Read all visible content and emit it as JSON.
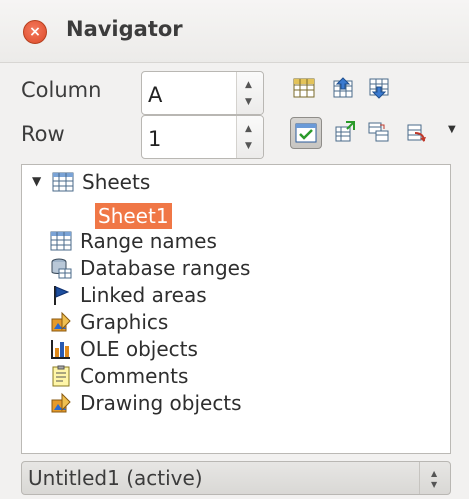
{
  "window": {
    "title": "Navigator"
  },
  "controls": {
    "column_label": "Column",
    "column_value": "A",
    "row_label": "Row",
    "row_value": "1"
  },
  "tree": {
    "root": {
      "label": "Sheets",
      "expanded": true,
      "icon": "table-icon"
    },
    "selected_child": "Sheet1",
    "items": [
      {
        "label": "Range names",
        "icon": "range-names-icon"
      },
      {
        "label": "Database ranges",
        "icon": "database-icon"
      },
      {
        "label": "Linked areas",
        "icon": "flag-icon"
      },
      {
        "label": "Graphics",
        "icon": "graphics-icon"
      },
      {
        "label": "OLE objects",
        "icon": "chart-icon"
      },
      {
        "label": "Comments",
        "icon": "note-icon"
      },
      {
        "label": "Drawing objects",
        "icon": "drawing-icon"
      }
    ]
  },
  "document_selector": {
    "value": "Untitled1 (active)"
  },
  "colors": {
    "selection": "#f07746",
    "close": "#dd4a29"
  }
}
